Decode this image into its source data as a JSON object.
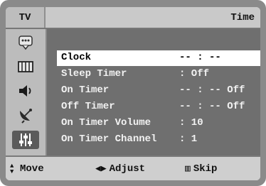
{
  "header": {
    "source_label": "TV",
    "menu_title": "Time"
  },
  "sidebar": {
    "items": [
      {
        "icon": "picture-icon",
        "selected": false
      },
      {
        "icon": "channel-grid-icon",
        "selected": false
      },
      {
        "icon": "speaker-icon",
        "selected": false
      },
      {
        "icon": "satellite-dish-icon",
        "selected": false
      },
      {
        "icon": "settings-sliders-icon",
        "selected": true
      }
    ]
  },
  "menu": {
    "items": [
      {
        "label": "Clock",
        "value": "-- : --",
        "selected": true
      },
      {
        "label": "Sleep Timer",
        "value": ": Off",
        "selected": false
      },
      {
        "label": "On Timer",
        "value": "-- : -- Off",
        "selected": false
      },
      {
        "label": "Off Timer",
        "value": "-- : -- Off",
        "selected": false
      },
      {
        "label": "On Timer Volume",
        "value": ": 10",
        "selected": false
      },
      {
        "label": "On Timer Channel",
        "value": ": 1",
        "selected": false
      }
    ]
  },
  "footer": {
    "move": {
      "glyph": "▲▼",
      "label": "Move"
    },
    "adjust": {
      "glyph": "◀▶",
      "label": "Adjust"
    },
    "skip": {
      "glyph": "▥",
      "label": "Skip"
    }
  }
}
